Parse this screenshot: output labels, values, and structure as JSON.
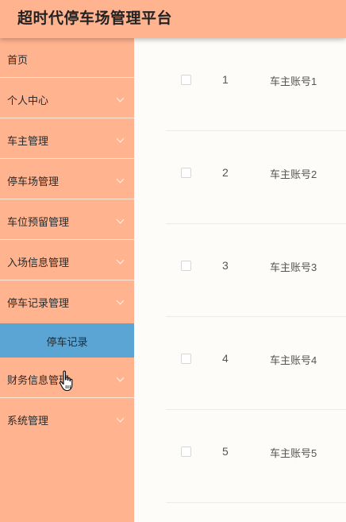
{
  "header": {
    "title": "超时代停车场管理平台"
  },
  "colors": {
    "header_bg": "#ffb38f",
    "sidebar_bg": "#ffb38f",
    "active_submenu_bg": "#5aa5d3",
    "content_bg": "#fdfcf9"
  },
  "sidebar": {
    "items": [
      {
        "label": "首页",
        "icon": "none"
      },
      {
        "label": "个人中心",
        "icon": "chevron-down-icon"
      },
      {
        "label": "车主管理",
        "icon": "chevron-down-icon"
      },
      {
        "label": "停车场管理",
        "icon": "chevron-down-icon"
      },
      {
        "label": "车位预留管理",
        "icon": "chevron-down-icon"
      },
      {
        "label": "入场信息管理",
        "icon": "chevron-down-icon"
      },
      {
        "label": "停车记录管理",
        "icon": "chevron-down-icon"
      },
      {
        "label": "财务信息管理",
        "icon": "chevron-down-icon"
      },
      {
        "label": "系统管理",
        "icon": "chevron-down-icon"
      }
    ],
    "active_submenu": {
      "label": "停车记录"
    }
  },
  "table": {
    "rows": [
      {
        "index": "1",
        "account": "车主账号1",
        "checked": false
      },
      {
        "index": "2",
        "account": "车主账号2",
        "checked": false
      },
      {
        "index": "3",
        "account": "车主账号3",
        "checked": false
      },
      {
        "index": "4",
        "account": "车主账号4",
        "checked": false
      },
      {
        "index": "5",
        "account": "车主账号5",
        "checked": false
      }
    ]
  }
}
